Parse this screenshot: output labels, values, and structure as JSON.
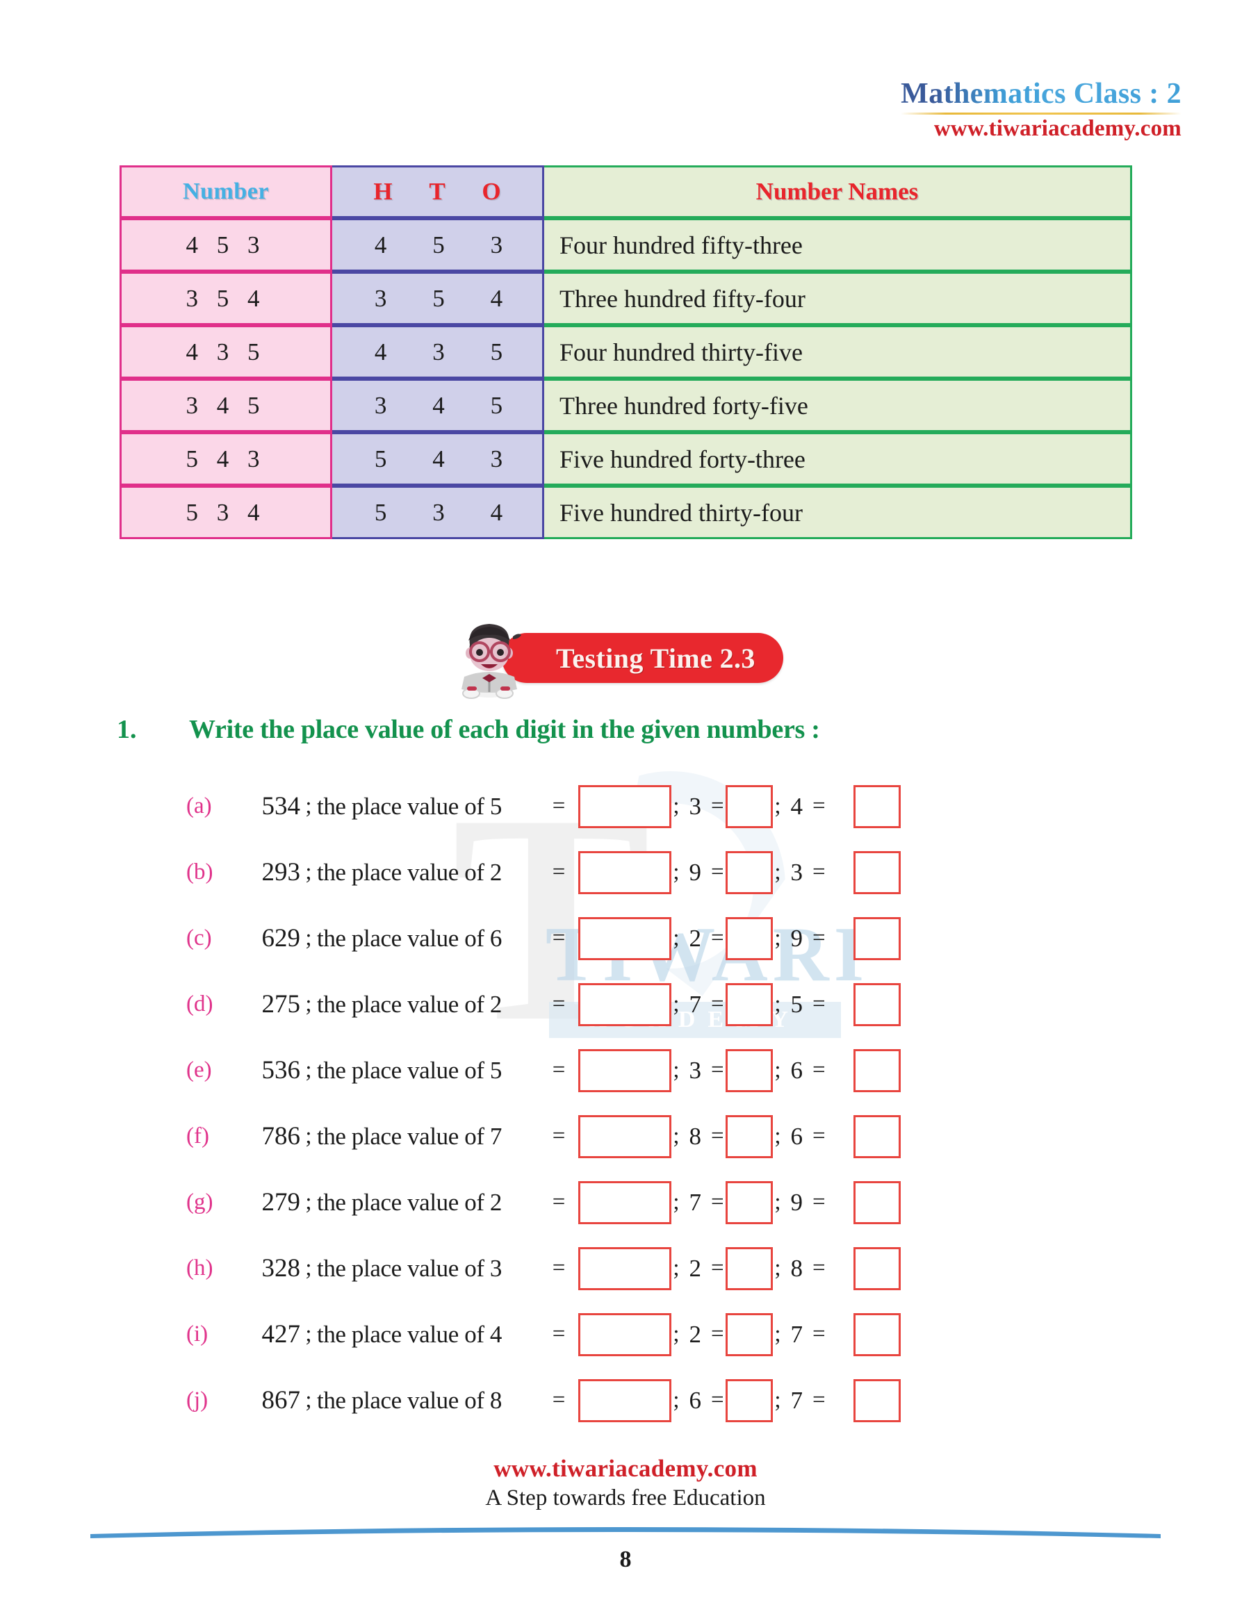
{
  "header": {
    "title": "Mathematics Class : 2",
    "site": "www.tiwariacademy.com"
  },
  "watermark": {
    "letter": "T",
    "word": "TIWARI",
    "sub": "ACADEMY"
  },
  "table": {
    "headers": {
      "number": "Number",
      "h": "H",
      "t": "T",
      "o": "O",
      "names": "Number Names"
    },
    "rows": [
      {
        "number": "4 5 3",
        "h": "4",
        "t": "5",
        "o": "3",
        "name": "Four hundred fifty-three"
      },
      {
        "number": "3 5 4",
        "h": "3",
        "t": "5",
        "o": "4",
        "name": "Three hundred fifty-four"
      },
      {
        "number": "4 3 5",
        "h": "4",
        "t": "3",
        "o": "5",
        "name": "Four hundred thirty-five"
      },
      {
        "number": "3 4 5",
        "h": "3",
        "t": "4",
        "o": "5",
        "name": "Three hundred forty-five"
      },
      {
        "number": "5 4 3",
        "h": "5",
        "t": "4",
        "o": "3",
        "name": "Five hundred forty-three"
      },
      {
        "number": "5 3 4",
        "h": "5",
        "t": "3",
        "o": "4",
        "name": "Five hundred thirty-four"
      }
    ]
  },
  "badge": {
    "label": "Testing Time 2.3"
  },
  "question": {
    "number": "1.",
    "text": "Write the place value of each digit in the given numbers :"
  },
  "exercises": [
    {
      "label": "(a)",
      "number": "534",
      "semi": ";",
      "phrase": "the place value of 5",
      "eq": "=",
      "sep1": ";",
      "d2": "3",
      "eq2": "=",
      "sep2": ";",
      "d3": "4",
      "eq3": "="
    },
    {
      "label": "(b)",
      "number": "293",
      "semi": ";",
      "phrase": "the place value of 2",
      "eq": "=",
      "sep1": ";",
      "d2": "9",
      "eq2": "=",
      "sep2": ";",
      "d3": "3",
      "eq3": "="
    },
    {
      "label": "(c)",
      "number": "629",
      "semi": ";",
      "phrase": "the place value of 6",
      "eq": "=",
      "sep1": ";",
      "d2": "2",
      "eq2": "=",
      "sep2": ";",
      "d3": "9",
      "eq3": "="
    },
    {
      "label": "(d)",
      "number": "275",
      "semi": ";",
      "phrase": "the place value of 2",
      "eq": "=",
      "sep1": ";",
      "d2": "7",
      "eq2": "=",
      "sep2": ";",
      "d3": "5",
      "eq3": "="
    },
    {
      "label": "(e)",
      "number": "536",
      "semi": ";",
      "phrase": "the place value of 5",
      "eq": "=",
      "sep1": ";",
      "d2": "3",
      "eq2": "=",
      "sep2": ";",
      "d3": "6",
      "eq3": "="
    },
    {
      "label": "(f)",
      "number": "786",
      "semi": ";",
      "phrase": "the place value of 7",
      "eq": "=",
      "sep1": ";",
      "d2": "8",
      "eq2": "=",
      "sep2": ";",
      "d3": "6",
      "eq3": "="
    },
    {
      "label": "(g)",
      "number": "279",
      "semi": ";",
      "phrase": "the place value of 2",
      "eq": "=",
      "sep1": ";",
      "d2": "7",
      "eq2": "=",
      "sep2": ";",
      "d3": "9",
      "eq3": "="
    },
    {
      "label": "(h)",
      "number": "328",
      "semi": ";",
      "phrase": "the place value of 3",
      "eq": "=",
      "sep1": ";",
      "d2": "2",
      "eq2": "=",
      "sep2": ";",
      "d3": "8",
      "eq3": "="
    },
    {
      "label": "(i)",
      "number": "427",
      "semi": ";",
      "phrase": "the place value of 4",
      "eq": "=",
      "sep1": ";",
      "d2": "2",
      "eq2": "=",
      "sep2": ";",
      "d3": "7",
      "eq3": "="
    },
    {
      "label": "(j)",
      "number": "867",
      "semi": ";",
      "phrase": "the place value of 8",
      "eq": "=",
      "sep1": ";",
      "d2": "6",
      "eq2": "=",
      "sep2": ";",
      "d3": "7",
      "eq3": "="
    }
  ],
  "footer": {
    "site": "www.tiwariacademy.com",
    "tagline": "A Step towards free Education",
    "page": "8"
  },
  "colors": {
    "title_blue": "#3f9fd8",
    "red": "#cf2028",
    "pink_bg": "#fbd7e8",
    "pink_border": "#e02f8a",
    "lav_bg": "#d0d0ea",
    "lav_border": "#4a47a3",
    "green_bg": "#e5eed5",
    "green_border": "#24ab5a",
    "badge_red": "#e8282e",
    "question_green": "#13924d",
    "label_pink": "#e0338b",
    "box_red": "#e8453f",
    "divider_blue": "#4d97cf"
  }
}
